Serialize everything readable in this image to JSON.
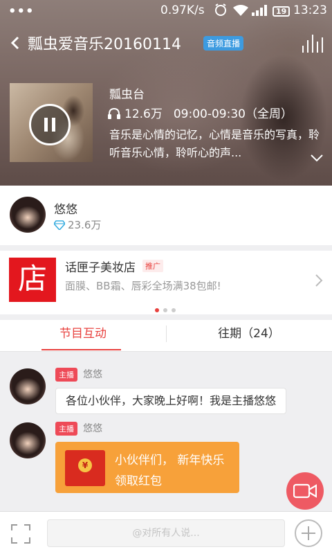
{
  "status_bar": {
    "dots": "•••",
    "speed": "0.97K/s",
    "battery": "19",
    "time": "13:23"
  },
  "header": {
    "title": "瓢虫爱音乐20160114",
    "badge": "音频直播"
  },
  "program": {
    "station": "瓢虫台",
    "listeners": "12.6万",
    "schedule": "09:00-09:30（全周）",
    "description": "音乐是心情的记忆，心情是音乐的写真，聆听音乐心情，聆听心的声..."
  },
  "host": {
    "name": "悠悠",
    "fans": "23.6万"
  },
  "ad": {
    "logo_text": "店",
    "title": "话匣子美妆店",
    "badge": "推广",
    "subtitle": "面膜、BB霜、唇彩全场满38包邮!",
    "pages": 3,
    "active_page": 1
  },
  "tabs": [
    {
      "label": "节目互动",
      "active": true
    },
    {
      "label": "往期（24）",
      "active": false
    }
  ],
  "messages": [
    {
      "role": "主播",
      "sender": "悠悠",
      "text": "各位小伙伴，大家晚上好啊！我是主播悠悠"
    },
    {
      "role": "主播",
      "sender": "悠悠",
      "redpack_line1": "小伙伴们， 新年快乐",
      "redpack_line2": "领取红包",
      "coin": "¥"
    }
  ],
  "input": {
    "placeholder": "@对所有人说..."
  },
  "colors": {
    "accent": "#e8413e",
    "redpack": "#f7a13a",
    "live_badge": "#3d9be0"
  }
}
